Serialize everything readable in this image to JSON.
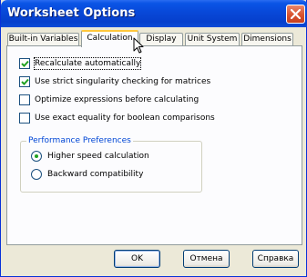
{
  "window": {
    "title": "Worksheet Options"
  },
  "tabs": [
    {
      "label": "Built-in Variables",
      "active": false
    },
    {
      "label": "Calculation",
      "active": true
    },
    {
      "label": "Display",
      "active": false
    },
    {
      "label": "Unit System",
      "active": false
    },
    {
      "label": "Dimensions",
      "active": false
    }
  ],
  "options": [
    {
      "label": "Recalculate automatically",
      "checked": true
    },
    {
      "label": "Use strict singularity checking for matrices",
      "checked": true
    },
    {
      "label": "Optimize expressions before calculating",
      "checked": false
    },
    {
      "label": "Use exact equality for boolean comparisons",
      "checked": false
    }
  ],
  "performance": {
    "title": "Performance Preferences",
    "options": [
      {
        "label": "Higher speed calculation",
        "selected": true
      },
      {
        "label": "Backward compatibility",
        "selected": false
      }
    ]
  },
  "buttons": {
    "ok": "OK",
    "cancel": "Отмена",
    "help": "Справка"
  },
  "colors": {
    "titlebar": "#0a55e6",
    "active_tab_accent": "#ffc73c",
    "group_title": "#0046d5",
    "check": "#21a121"
  }
}
